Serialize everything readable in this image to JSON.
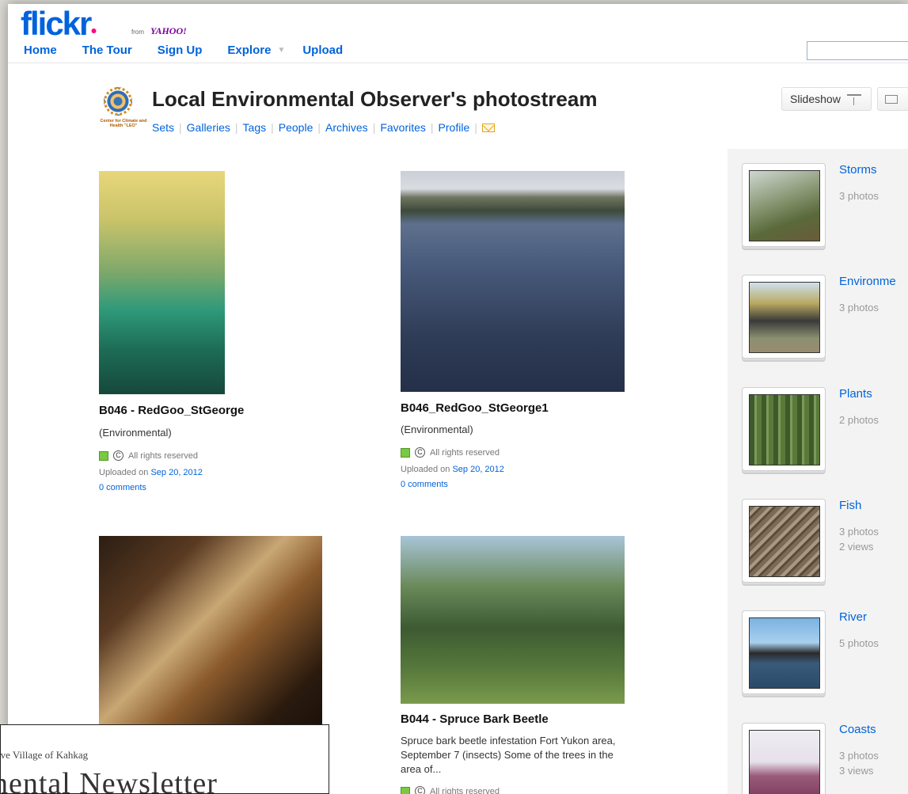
{
  "header": {
    "logo_text": "flickr",
    "logo_from": "from",
    "logo_yahoo": "YAHOO!",
    "nav": [
      "Home",
      "The Tour",
      "Sign Up",
      "Explore",
      "Upload"
    ],
    "search_placeholder": ""
  },
  "profile": {
    "avatar_label": "Center for Climate and Health \"LEO\"",
    "title": "Local Environmental Observer's photostream",
    "subnav": [
      "Sets",
      "Galleries",
      "Tags",
      "People",
      "Archives",
      "Favorites",
      "Profile"
    ],
    "slideshow_label": "Slideshow"
  },
  "photos": [
    {
      "title": "B046 - RedGoo_StGeorge",
      "subtitle": "(Environmental)",
      "rights": "All rights reserved",
      "uploaded_prefix": "Uploaded on",
      "uploaded_date": "Sep 20, 2012",
      "comments": "0 comments"
    },
    {
      "title": "B046_RedGoo_StGeorge1",
      "subtitle": "(Environmental)",
      "rights": "All rights reserved",
      "uploaded_prefix": "Uploaded on",
      "uploaded_date": "Sep 20, 2012",
      "comments": "0 comments"
    },
    {
      "title": "",
      "subtitle": "",
      "rights": "",
      "uploaded_prefix": "",
      "uploaded_date": "",
      "comments": ""
    },
    {
      "title": "B044 - Spruce Bark Beetle",
      "description": "Spruce bark beetle infestation Fort Yukon area, September 7 (insects) Some of the trees in the area of...",
      "rights": "All rights reserved"
    }
  ],
  "sets": [
    {
      "name": "Storms",
      "count": "3 photos",
      "views": ""
    },
    {
      "name": "Environme",
      "count": "3 photos",
      "views": ""
    },
    {
      "name": "Plants",
      "count": "2 photos",
      "views": ""
    },
    {
      "name": "Fish",
      "count": "3 photos",
      "views": "2 views"
    },
    {
      "name": "River",
      "count": "5 photos",
      "views": ""
    },
    {
      "name": "Coasts",
      "count": "3 photos",
      "views": "3 views"
    }
  ],
  "overlay": {
    "subtitle": "ive Village of Kahkag",
    "title": "nental Newsletter"
  },
  "colors": {
    "link": "#0063dc",
    "brand_pink": "#ff0084",
    "license_green": "#7ac943"
  }
}
